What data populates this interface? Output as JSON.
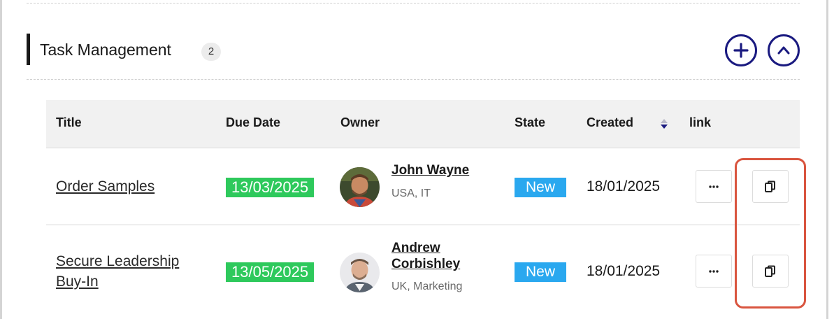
{
  "section": {
    "title": "Task Management",
    "count": "2"
  },
  "columns": {
    "title": "Title",
    "due_date": "Due Date",
    "owner": "Owner",
    "state": "State",
    "created": "Created",
    "link": "link"
  },
  "rows": [
    {
      "title_line1": "Order Samples",
      "title_line2": "",
      "due_date": "13/03/2025",
      "owner_name_line1": "John Wayne",
      "owner_name_line2": "",
      "owner_meta": "USA, IT",
      "state": "New",
      "created": "18/01/2025",
      "more_label": "···"
    },
    {
      "title_line1": "Secure Leadership",
      "title_line2": "Buy-In",
      "due_date": "13/05/2025",
      "owner_name_line1": "Andrew",
      "owner_name_line2": "Corbishley",
      "owner_meta": "UK, Marketing",
      "state": "New",
      "created": "18/01/2025",
      "more_label": "···"
    }
  ],
  "colors": {
    "accent": "#1a1a80",
    "due_badge": "#2ec95c",
    "state_badge": "#2aa8ef",
    "highlight": "#d9553f"
  },
  "icons": {
    "add": "plus-icon",
    "collapse": "chevron-up-icon",
    "sort": "sort-icon",
    "copy": "copy-icon",
    "more": "ellipsis-icon"
  }
}
